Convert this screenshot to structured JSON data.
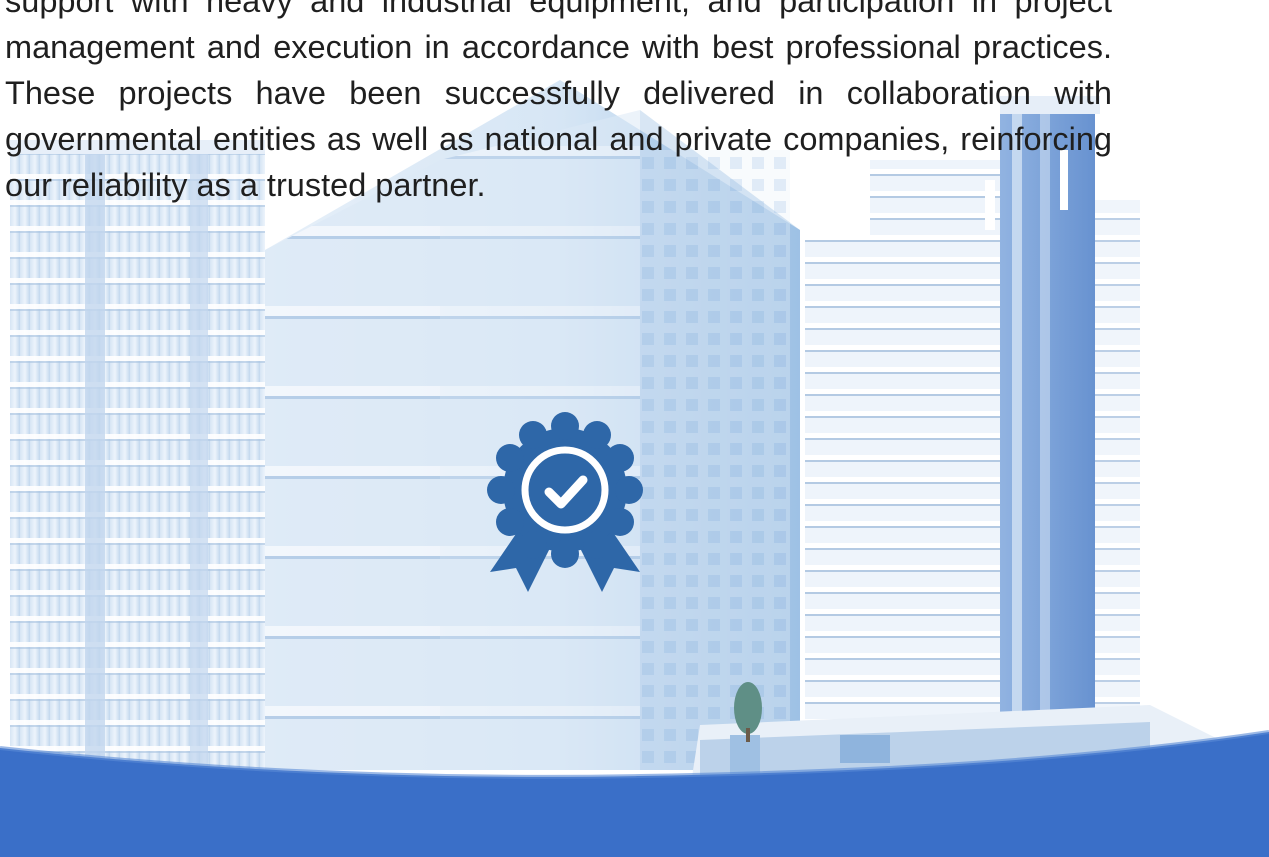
{
  "text": {
    "paragraph": "support with heavy and industrial equipment, and participation in project management and execution in accordance with best professional practices. These projects have been successfully delivered in collaboration with governmental entities as well as national and private companies, reinforcing our reliability as a trusted partner."
  },
  "colors": {
    "text": "#1f1f1f",
    "accent": "#2e67a8",
    "wave_primary": "#3a6fc8",
    "building_light": "#dbe9f7",
    "building_mid": "#a9c6e6"
  },
  "icons": {
    "badge": "quality-badge-icon"
  }
}
